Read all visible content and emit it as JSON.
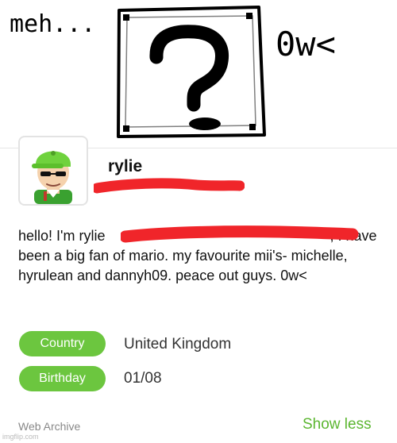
{
  "drawing": {
    "left_text": "meh...",
    "right_text": "0w<",
    "block_symbol": "?"
  },
  "profile": {
    "username": "rylie",
    "bio_start": "hello! I'm rylie",
    "bio_continued": ", I have been a big fan of mario. my favourite mii's- michelle, hyrulean and dannyh09. peace out guys. 0w<",
    "country_label": "Country",
    "country_value": "United Kingdom",
    "birthday_label": "Birthday",
    "birthday_value": "01/08"
  },
  "footer": {
    "source": "Web Archive",
    "show_less": "Show less",
    "watermark": "imgflip.com"
  },
  "colors": {
    "accent_green": "#6cc63f",
    "redaction_red": "#f0252a"
  }
}
